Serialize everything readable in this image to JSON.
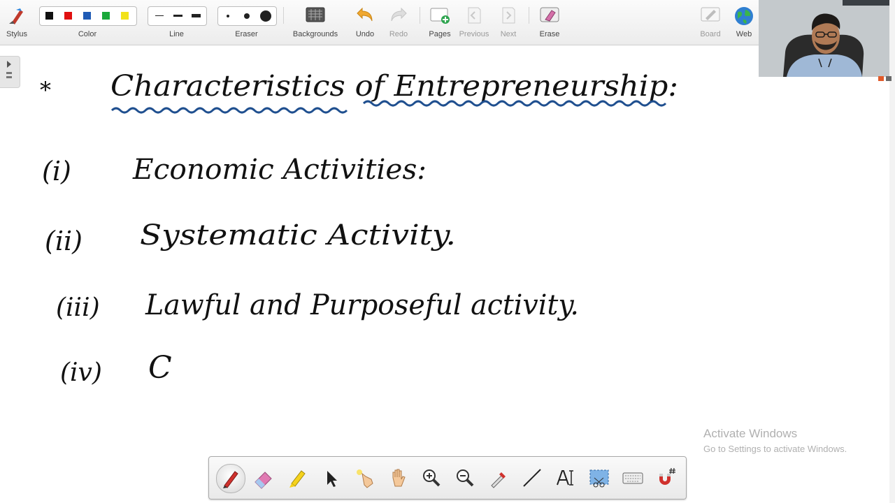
{
  "toolbar": {
    "stylus": "Stylus",
    "color": "Color",
    "line": "Line",
    "eraser": "Eraser",
    "backgrounds": "Backgrounds",
    "undo": "Undo",
    "redo": "Redo",
    "pages": "Pages",
    "previous": "Previous",
    "next": "Next",
    "erase": "Erase",
    "board": "Board",
    "web": "Web",
    "colors": [
      "#111111",
      "#e01010",
      "#1f5bb5",
      "#1aa83a",
      "#f2e21a"
    ]
  },
  "board": {
    "heading_marker": "*",
    "heading": "Characteristics of Entrepreneurship:",
    "items": [
      {
        "num": "(i)",
        "text": "Economic Activities:"
      },
      {
        "num": "(ii)",
        "text": "Systematic Activity."
      },
      {
        "num": "(iii)",
        "text": "Lawful and Purposeful activity."
      },
      {
        "num": "(iv)",
        "text": "C"
      }
    ],
    "ink_color": "#111111",
    "underline_color": "#1f4f8f"
  },
  "watermark": {
    "title": "Activate Windows",
    "subtitle": "Go to Settings to activate Windows."
  },
  "bottom_tools": [
    "pen-icon",
    "eraser-icon",
    "highlighter-icon",
    "pointer-icon",
    "laser-pointer-icon",
    "hand-pan-icon",
    "zoom-in-icon",
    "zoom-out-icon",
    "dropper-icon",
    "line-tool-icon",
    "text-tool-icon",
    "screen-capture-icon",
    "keyboard-icon",
    "magnet-icon"
  ]
}
